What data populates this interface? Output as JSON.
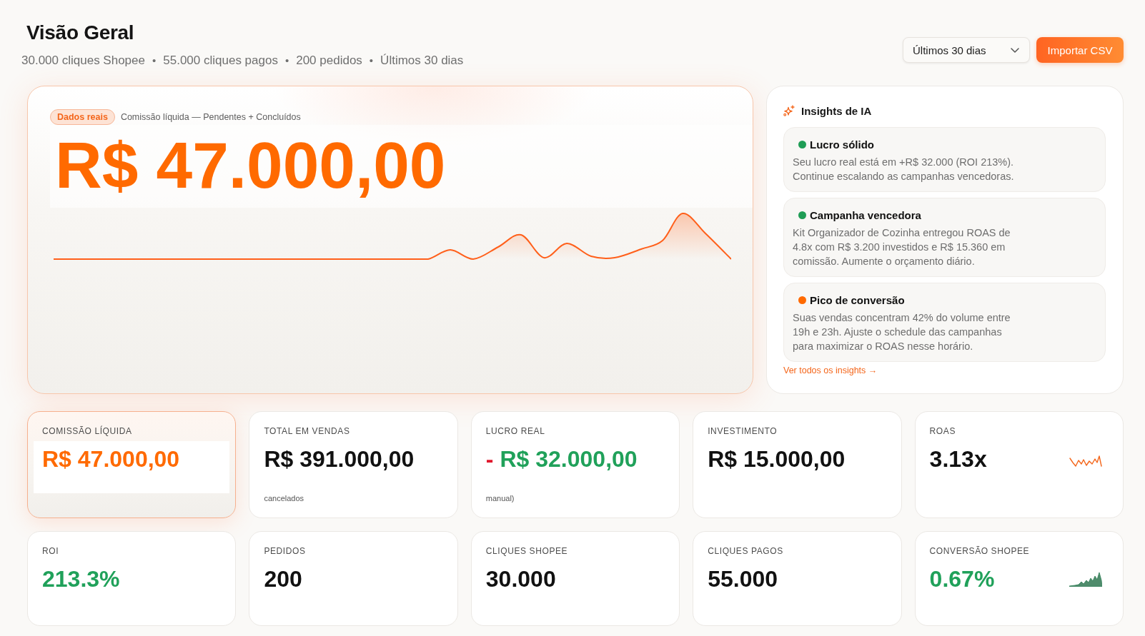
{
  "page": {
    "title": "Visão Geral",
    "summary": [
      "30.000 cliques Shopee",
      "55.000 cliques pagos",
      "200 pedidos",
      "Últimos 30 dias"
    ],
    "separator": "•"
  },
  "period_select": {
    "value": "Últimos 30 dias"
  },
  "import_button": {
    "label": "Importar CSV"
  },
  "hero": {
    "badge": "Dados reais",
    "caption": "Comissão líquida — Pendentes + Concluídos",
    "value": "R$ 47.000,00"
  },
  "insights": {
    "title": "Insights de IA",
    "items": [
      {
        "title": "Lucro sólido",
        "text": "Seu lucro real está em +R$ 32.000 (ROI 213%). Continue escalando as campanhas vencedoras.",
        "color": "#1f9d55"
      },
      {
        "title": "Campanha vencedora",
        "text": "Kit Organizador de Cozinha entregou ROAS de 4.8x com R$ 3.200 investidos e R$ 15.360 em comissão. Aumente o orçamento diário.",
        "color": "#1f9d55"
      },
      {
        "title": "Pico de conversão",
        "text": "Suas vendas concentram 42% do volume entre 19h e 23h. Ajuste o schedule das campanhas para maximizar o ROAS nesse horário.",
        "color": "#ff6a00"
      }
    ],
    "link": "Ver todos os insights →"
  },
  "kpis": [
    {
      "label": "COMISSÃO LÍQUIDA",
      "value": "R$ 47.000,00",
      "color": "#ff6a00",
      "featured": true,
      "kind": "plain"
    },
    {
      "label": "TOTAL EM VENDAS",
      "value": "R$ 391.000,00",
      "color": "#111111",
      "featured": false,
      "kind": "plain",
      "note": "cancelados"
    },
    {
      "label": "LUCRO REAL",
      "prefix": "-",
      "value": "R$ 32.000,00",
      "color": "#20a15a",
      "featured": false,
      "kind": "plain",
      "note": "manual)"
    },
    {
      "label": "INVESTIMENTO",
      "value": "R$ 15.000,00",
      "color": "#111111",
      "featured": false,
      "kind": "plain"
    },
    {
      "label": "ROAS",
      "value": "3.13x",
      "color": "#111111",
      "featured": false,
      "kind": "line-spark"
    },
    {
      "label": "ROI",
      "value": "213.3%",
      "color": "#20a15a",
      "featured": false,
      "kind": "plain"
    },
    {
      "label": "PEDIDOS",
      "value": "200",
      "color": "#111111",
      "featured": false,
      "kind": "plain"
    },
    {
      "label": "CLIQUES SHOPEE",
      "value": "30.000",
      "color": "#111111",
      "featured": false,
      "kind": "plain"
    },
    {
      "label": "CLIQUES PAGOS",
      "value": "55.000",
      "color": "#111111",
      "featured": false,
      "kind": "plain"
    },
    {
      "label": "CONVERSÃO SHOPEE",
      "value": "0.67%",
      "color": "#20a15a",
      "featured": false,
      "kind": "area-spark"
    }
  ]
}
